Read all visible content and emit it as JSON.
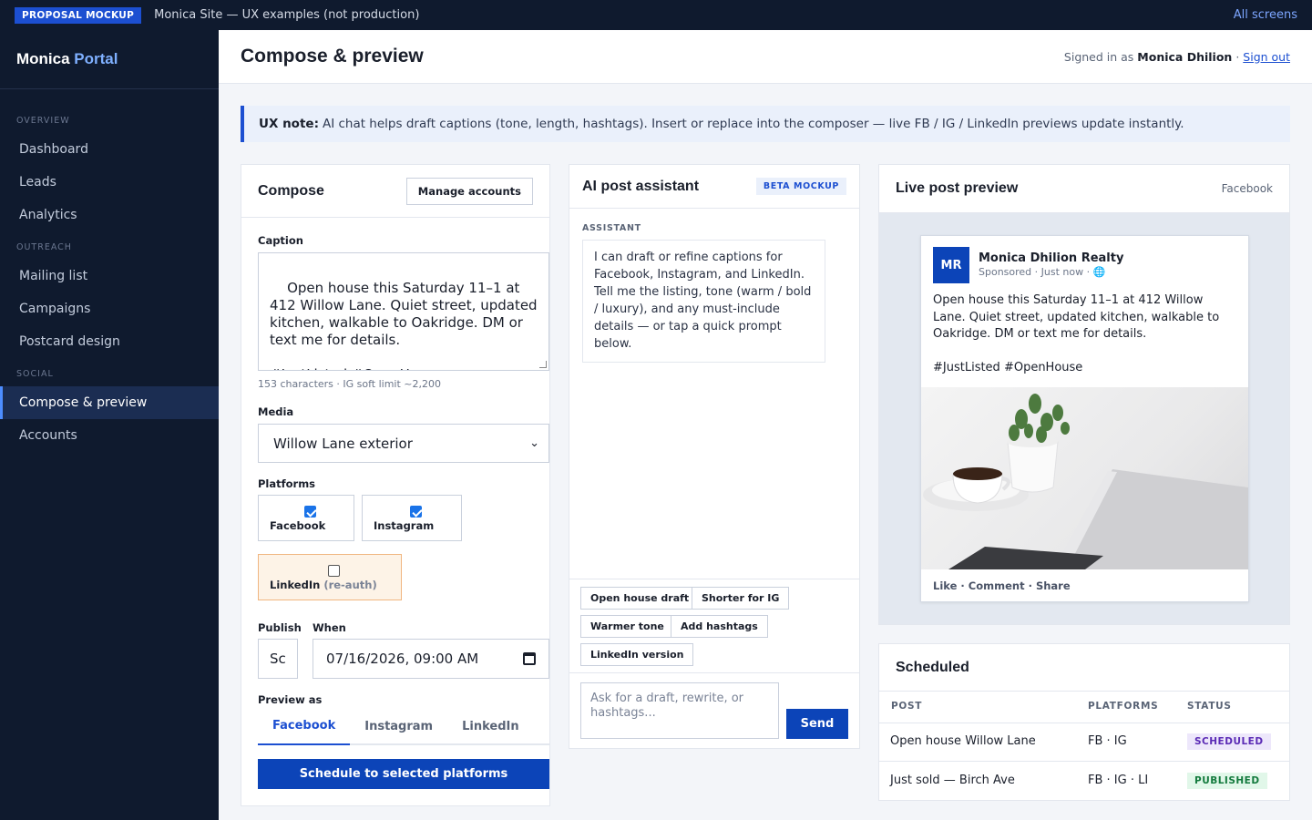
{
  "topbar": {
    "badge": "PROPOSAL MOCKUP",
    "title": "Monica Site — UX examples (not production)",
    "all_screens": "All screens"
  },
  "sidebar": {
    "brand_main": "Monica",
    "brand_accent": "Portal",
    "sections": [
      {
        "label": "OVERVIEW",
        "items": [
          {
            "label": "Dashboard"
          },
          {
            "label": "Leads"
          },
          {
            "label": "Analytics"
          }
        ]
      },
      {
        "label": "OUTREACH",
        "items": [
          {
            "label": "Mailing list"
          },
          {
            "label": "Campaigns"
          },
          {
            "label": "Postcard design"
          }
        ]
      },
      {
        "label": "SOCIAL",
        "items": [
          {
            "label": "Compose & preview",
            "active": true
          },
          {
            "label": "Accounts"
          }
        ]
      }
    ]
  },
  "header": {
    "title": "Compose & preview",
    "signed_in_prefix": "Signed in as",
    "user_name": "Monica Dhilion",
    "separator": "·",
    "sign_out": "Sign out"
  },
  "note": {
    "label": "UX note:",
    "text": "AI chat helps draft captions (tone, length, hashtags). Insert or replace into the composer — live FB / IG / LinkedIn previews update instantly."
  },
  "compose": {
    "title": "Compose",
    "manage_accounts": "Manage accounts",
    "caption_label": "Caption",
    "caption_value": "Open house this Saturday 11–1 at 412 Willow Lane. Quiet street, updated kitchen, walkable to Oakridge. DM or text me for details.\n\n#JustListed #OpenHouse",
    "char_hint": "153 characters · IG soft limit ~2,200",
    "media_label": "Media",
    "media_value": "Willow Lane exterior",
    "platforms_label": "Platforms",
    "platforms": [
      {
        "label": "Facebook",
        "checked": true
      },
      {
        "label": "Instagram",
        "checked": true
      },
      {
        "label": "LinkedIn",
        "note": "(re-auth)",
        "checked": false
      }
    ],
    "publish_label": "Publish",
    "publish_value": "Sc",
    "when_label": "When",
    "when_value": "07/16/2026, 09:00 AM",
    "preview_as_label": "Preview as",
    "preview_tabs": [
      {
        "label": "Facebook",
        "active": true
      },
      {
        "label": "Instagram"
      },
      {
        "label": "LinkedIn"
      }
    ],
    "schedule_button": "Schedule to selected platforms"
  },
  "assistant": {
    "title": "AI post assistant",
    "beta": "BETA MOCKUP",
    "role_label": "ASSISTANT",
    "message": "I can draft or refine captions for Facebook, Instagram, and LinkedIn. Tell me the listing, tone (warm / bold / luxury), and any must-include details — or tap a quick prompt below.",
    "chips": [
      "Open house draft",
      "Shorter for IG",
      "Warmer tone",
      "Add hashtags",
      "LinkedIn version"
    ],
    "input_placeholder": "Ask for a draft, rewrite, or hashtags...",
    "send": "Send"
  },
  "preview": {
    "title": "Live post preview",
    "platform": "Facebook",
    "avatar_initials": "MR",
    "page_name": "Monica Dhilion Realty",
    "meta": "Sponsored · Just now · 🌐",
    "post_text": "Open house this Saturday 11–1 at 412 Willow Lane. Quiet street, updated kitchen, walkable to Oakridge. DM or text me for details.\n\n#JustListed #OpenHouse",
    "actions": "Like · Comment · Share"
  },
  "scheduled": {
    "title": "Scheduled",
    "columns": [
      "POST",
      "PLATFORMS",
      "STATUS"
    ],
    "rows": [
      {
        "post": "Open house Willow Lane",
        "platforms": "FB · IG",
        "status": "SCHEDULED"
      },
      {
        "post": "Just sold — Birch Ave",
        "platforms": "FB · IG · LI",
        "status": "PUBLISHED"
      }
    ]
  },
  "colors": {
    "primary": "#0c44b8",
    "sidebar_bg": "#0f1a2e",
    "scheduled_badge": "#5b2bb5",
    "published_badge": "#137a3d"
  }
}
